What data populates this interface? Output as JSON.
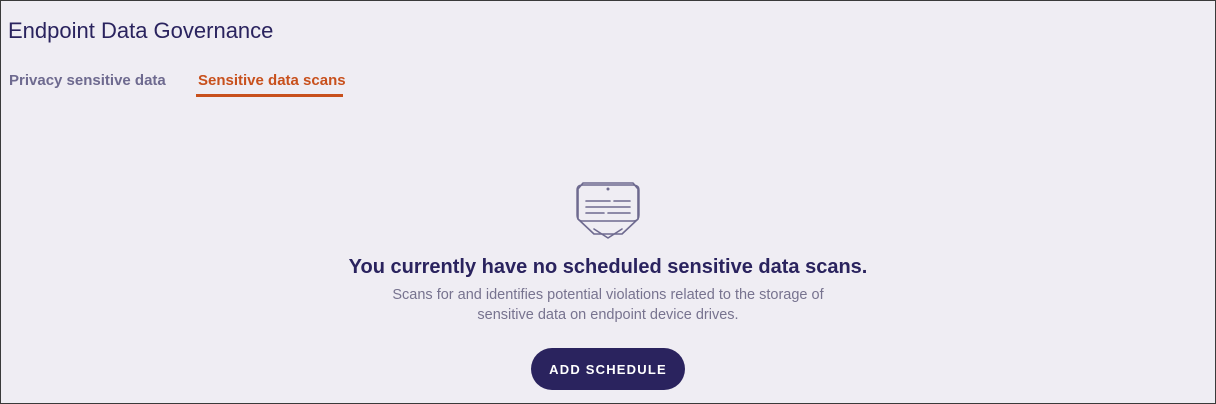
{
  "page": {
    "title": "Endpoint Data Governance"
  },
  "tabs": [
    {
      "label": "Privacy sensitive data",
      "active": false
    },
    {
      "label": "Sensitive data scans",
      "active": true
    }
  ],
  "empty_state": {
    "icon": "document-scan-icon",
    "title": "You currently have no scheduled sensitive data scans.",
    "description_line1": "Scans for and identifies potential violations related to the storage of",
    "description_line2": "sensitive data on endpoint device drives.",
    "button_label": "ADD SCHEDULE"
  },
  "colors": {
    "background": "#efedf3",
    "primary": "#2a235e",
    "accent": "#c8501c",
    "muted_text": "#77738f",
    "inactive_tab": "#6e6a8f"
  }
}
